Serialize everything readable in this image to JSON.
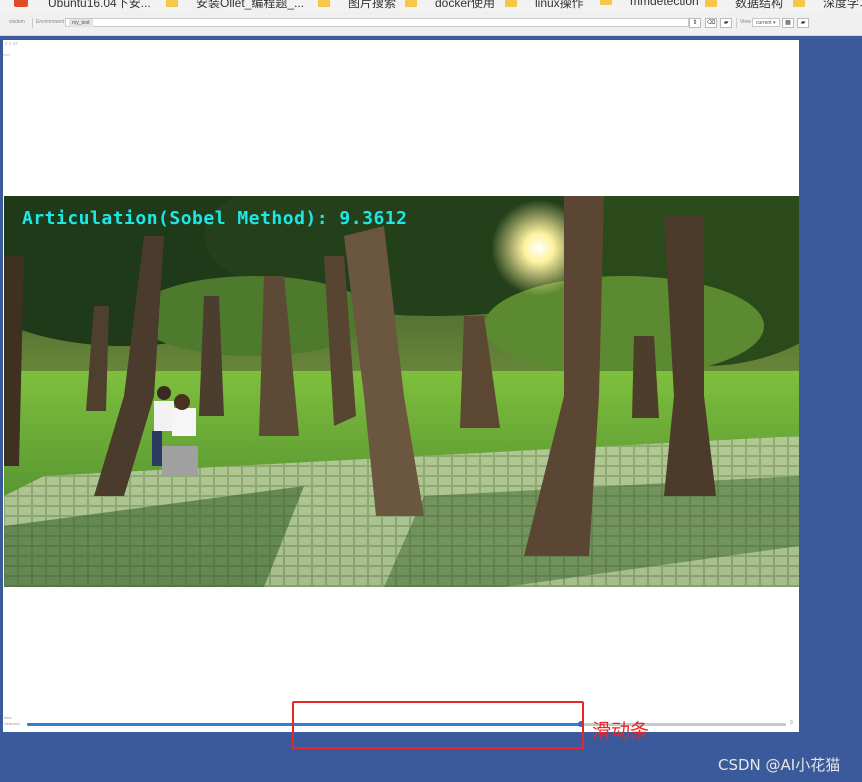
{
  "bookmarks": [
    {
      "label": "Ubuntu16.04下安..."
    },
    {
      "label": "安装Ollet_编程题_..."
    },
    {
      "label": "图片搜索"
    },
    {
      "label": "docker使用"
    },
    {
      "label": "linux操作"
    },
    {
      "label": "mmdetection"
    },
    {
      "label": "数据结构"
    },
    {
      "label": "深度学习..."
    }
  ],
  "toolbar": {
    "visdom_label": "visdom",
    "environment_label": "Environment",
    "environment_value": "my_test",
    "view_label": "View",
    "view_value": "current"
  },
  "pane": {
    "title_tiny": "x  x  xx",
    "subtitle_tiny": "time",
    "overlay_text": "Articulation(Sobel Method): 9.3612",
    "slider_label_1": "time",
    "slider_label_2": "Selected",
    "slider_value_fraction": 0.73,
    "slider_max_label": "9"
  },
  "annotation": {
    "label": "滑动条",
    "color": "#e8262a"
  },
  "watermark": "CSDN @AI小花猫",
  "colors": {
    "background": "#3a5a9b",
    "overlay_text": "#1ce8e8",
    "slider": "#2f7fd4"
  }
}
